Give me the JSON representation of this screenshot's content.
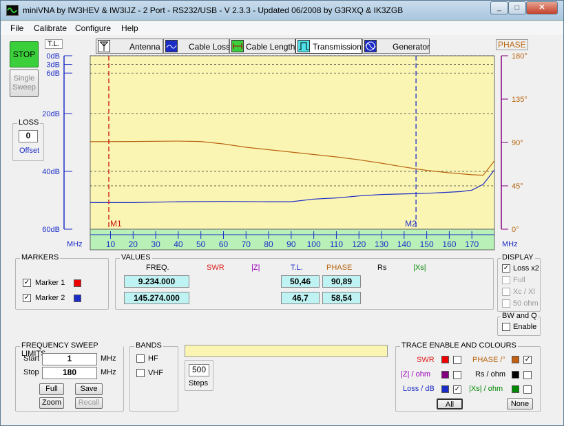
{
  "window": {
    "title": "miniVNA by IW3HEV & IW3IJZ - 2 Port - RS232/USB - V 2.3.3 - Updated 06/2008 by G3RXQ & IK3ZGB"
  },
  "menu": [
    "File",
    "Calibrate",
    "Configure",
    "Help"
  ],
  "left_panel": {
    "stop": "STOP",
    "single_line1": "Single",
    "single_line2": "Sweep",
    "tl_label": "T.L.",
    "loss_title": "LOSS",
    "loss_value": "0",
    "offset_label": "Offset"
  },
  "tabs": [
    {
      "label": "Antenna"
    },
    {
      "label": "Cable Loss"
    },
    {
      "label": "Cable Length"
    },
    {
      "label": "Transmission"
    },
    {
      "label": "Generator"
    }
  ],
  "colors": {
    "plot_bg": "#fbf5b4",
    "freq_bar": "#b8f0b8",
    "phase": "#b8650f",
    "loss": "#1c2cc6",
    "m1": "#cc1111",
    "m2": "#1c2cc6"
  },
  "chart_data": {
    "type": "line",
    "xlabel": "MHz",
    "x_ticks": [
      "10",
      "20",
      "30",
      "40",
      "50",
      "60",
      "70",
      "80",
      "90",
      "100",
      "110",
      "120",
      "130",
      "140",
      "150",
      "160",
      "170"
    ],
    "left_axis_label": "T.L.",
    "left_ticks": [
      "0dB",
      "3dB",
      "6dB",
      "20dB",
      "40dB",
      "60dB"
    ],
    "right_axis_label": "PHASE",
    "right_ticks": [
      "180°",
      "135°",
      "90°",
      "45°",
      "0°"
    ],
    "xlim": [
      1,
      180
    ],
    "ylim_left_db": [
      0,
      60
    ],
    "ylim_right_deg": [
      0,
      180
    ],
    "series": [
      {
        "name": "Loss",
        "color": "#1c2cc6",
        "x": [
          1,
          20,
          40,
          60,
          80,
          90,
          100,
          110,
          120,
          130,
          140,
          150,
          160,
          165,
          170,
          175,
          180
        ],
        "y": [
          50.8,
          50.8,
          50.5,
          50.4,
          50.5,
          50.5,
          49.6,
          49.2,
          48.5,
          48.0,
          47.8,
          47.6,
          47.2,
          47.0,
          46.5,
          44.5,
          39.5
        ]
      },
      {
        "name": "Phase",
        "color": "#b8650f",
        "x": [
          1,
          20,
          40,
          50,
          60,
          70,
          80,
          90,
          100,
          110,
          120,
          130,
          140,
          150,
          160,
          165,
          170,
          175,
          180
        ],
        "y": [
          90.8,
          91.0,
          91.4,
          91.0,
          88.5,
          85.0,
          82.5,
          80.0,
          77.5,
          75.0,
          72.0,
          68.5,
          64.5,
          61.0,
          58.5,
          57.5,
          56.5,
          56.0,
          71.0
        ]
      }
    ],
    "markers": [
      {
        "label": "M1",
        "freq": 9.234
      },
      {
        "label": "M2",
        "freq": 145.274
      }
    ],
    "grid_db": [
      0,
      3,
      6,
      20,
      40,
      45,
      60
    ]
  },
  "markers_panel": {
    "title": "MARKERS",
    "m1": "Marker 1",
    "m2": "Marker 2"
  },
  "values": {
    "title": "VALUES",
    "freq_h": "FREQ.",
    "swr_h": "SWR",
    "z_h": "|Z|",
    "tl_h": "T.L.",
    "phase_h": "PHASE",
    "rs_h": "Rs",
    "xs_h": "|Xs|",
    "rows": [
      {
        "freq": "9.234.000",
        "tl": "50,46",
        "phase": "90,89"
      },
      {
        "freq": "145.274.000",
        "tl": "46,7",
        "phase": "58,54"
      }
    ]
  },
  "display": {
    "title": "DISPLAY",
    "loss_x2": "Loss x2",
    "full": "Full",
    "xcxl": "Xc / Xl",
    "ohm50": "50 ohm"
  },
  "bwq": {
    "title": "BW and Q",
    "enable": "Enable"
  },
  "sweep": {
    "title": "FREQUENCY SWEEP LIMITS",
    "start_label": "Start",
    "start": "1",
    "stop_label": "Stop",
    "stop": "180",
    "unit": "MHz",
    "full": "Full",
    "save": "Save",
    "zoom": "Zoom",
    "recall": "Recall"
  },
  "bands": {
    "title": "BANDS",
    "hf": "HF",
    "vhf": "VHF"
  },
  "steps": {
    "value": "500",
    "label": "Steps"
  },
  "trace": {
    "title": "TRACE ENABLE AND COLOURS",
    "swr": "SWR",
    "phase": "PHASE /°",
    "z": "|Z| / ohm",
    "rs": "Rs / ohm",
    "loss": "Loss / dB",
    "xs": "|Xs| / ohm",
    "all": "All",
    "none": "None"
  }
}
